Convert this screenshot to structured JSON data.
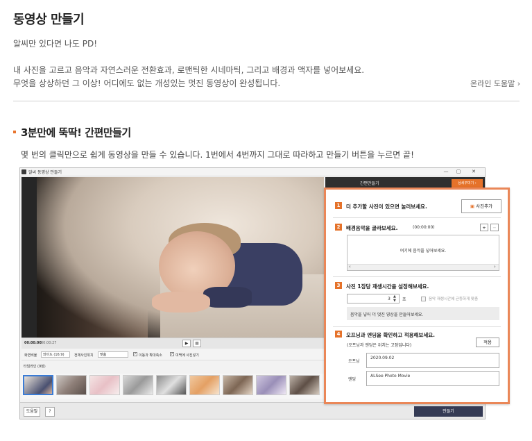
{
  "header": {
    "title": "동영상 만들기",
    "subtitle": "알씨만 있다면 나도 PD!",
    "desc_line1": "내 사진을 고르고 음악과 자연스러운 전환효과, 로맨틱한 시네마틱, 그리고 배경과 액자를 넣어보세요.",
    "desc_line2": "무엇을 상상하던 그 이상! 어디에도 없는 개성있는 멋진 동영상이 완성됩니다.",
    "help_link": "온라인 도움말 ›"
  },
  "section": {
    "title": "3분만에 뚝딱! 간편만들기",
    "desc": "몇 번의 클릭만으로 쉽게 동영상을 만들 수 있습니다. 1번에서 4번까지 그대로 따라하고 만들기 버튼을 누르면 끝!"
  },
  "app": {
    "window_title": "알씨 동영상 만들기",
    "window_buttons": [
      "—",
      "▢",
      "✕"
    ],
    "panel_header": "간편만들기",
    "detail_button": "상세꾸미기 ›",
    "time_current": "00:00:00",
    "time_total": "00:00:27",
    "play_icon": "▶",
    "stop_icon": "■",
    "opt_ratio_label": "화면비율",
    "opt_ratio_value": "와이드 (16:9)",
    "opt_transition_label": "전체사진위치",
    "opt_transition_value": "맞춤",
    "opt_check1": "이동과 확대축소",
    "opt_check2": "여백에 사진넣기",
    "timeline_label": "타임라인 (9장)",
    "help_button": "도움말",
    "question_button": "?",
    "make_button": "만들기"
  },
  "guide": {
    "step1_num": "1",
    "step1_title": "더 추가할 사진이 있으면 눌러보세요.",
    "add_photo_button": "사진추가",
    "step2_num": "2",
    "step2_title": "배경음악을 골라보세요.",
    "step2_time": "(00:00:00)",
    "music_placeholder": "여기에 음악을 넣어보세요.",
    "plus_icon": "+",
    "minus_icon": "−",
    "step3_num": "3",
    "step3_title": "사진 1장당 재생시간을 설정해보세요.",
    "duration_value": "3",
    "duration_unit": "초",
    "fit_music_label": "음악 재생시간에 균등하게 맞춤",
    "step3_note": "음악을 넣어 더 멋진 영상을 만들어보세요.",
    "step4_num": "4",
    "step4_title": "오프닝과 엔딩을 확인하고 적용해보세요.",
    "step4_sub": "(오프닝과 엔딩은 위치는 고정입니다)",
    "apply_button": "적용",
    "opening_label": "오프닝",
    "opening_value": "2020.09.02",
    "ending_label": "엔딩",
    "ending_value": "ALSee Photo Movie"
  },
  "colors": {
    "accent": "#e5722a",
    "overlay_border": "#ea8758",
    "make_button_bg": "#353b55"
  }
}
